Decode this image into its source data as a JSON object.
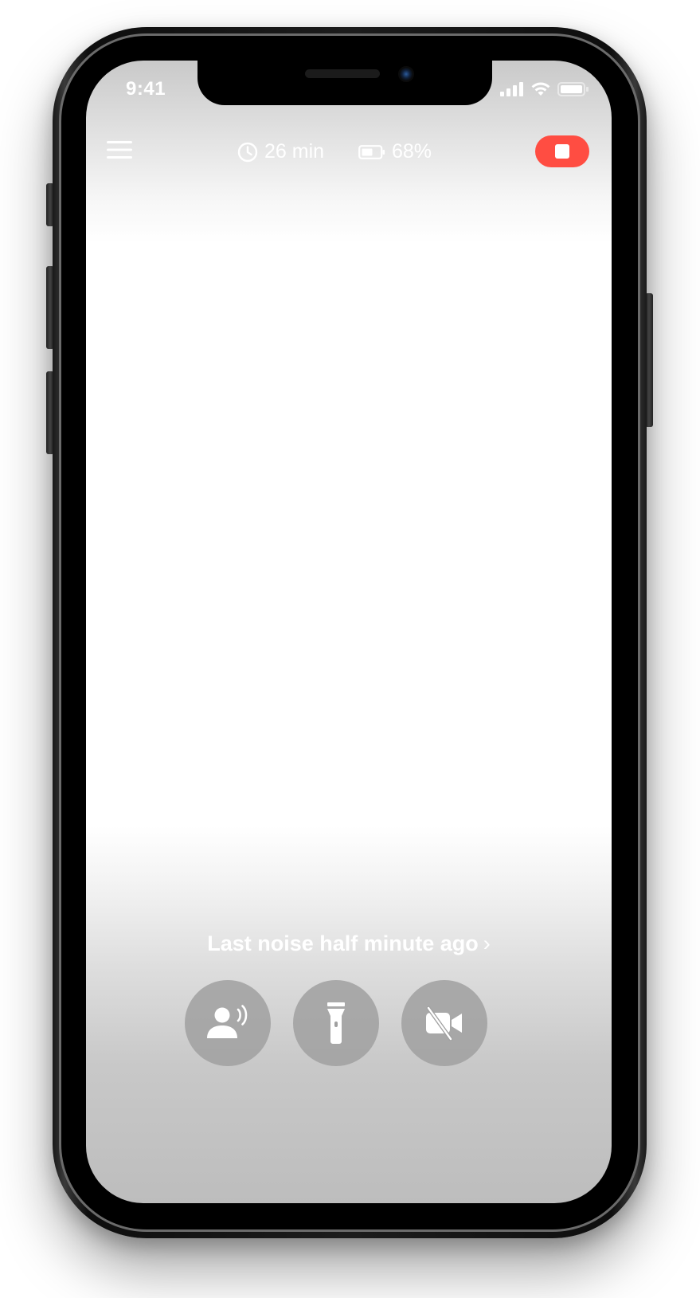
{
  "status_bar": {
    "time": "9:41",
    "icons": [
      "cellular-signal-icon",
      "wifi-icon",
      "battery-icon"
    ]
  },
  "top_bar": {
    "menu_icon": "hamburger-menu-icon",
    "duration": "26 min",
    "duration_icon": "clock-icon",
    "battery": "68%",
    "battery_icon": "battery-icon",
    "stop_icon": "stop-icon",
    "stop_color": "#ff4d42"
  },
  "footer": {
    "last_noise": "Last noise half minute ago",
    "chevron": "›"
  },
  "controls": [
    {
      "name": "talk-button",
      "icon": "person-speaking-icon"
    },
    {
      "name": "flashlight-button",
      "icon": "flashlight-icon"
    },
    {
      "name": "video-off-button",
      "icon": "video-off-icon"
    }
  ]
}
